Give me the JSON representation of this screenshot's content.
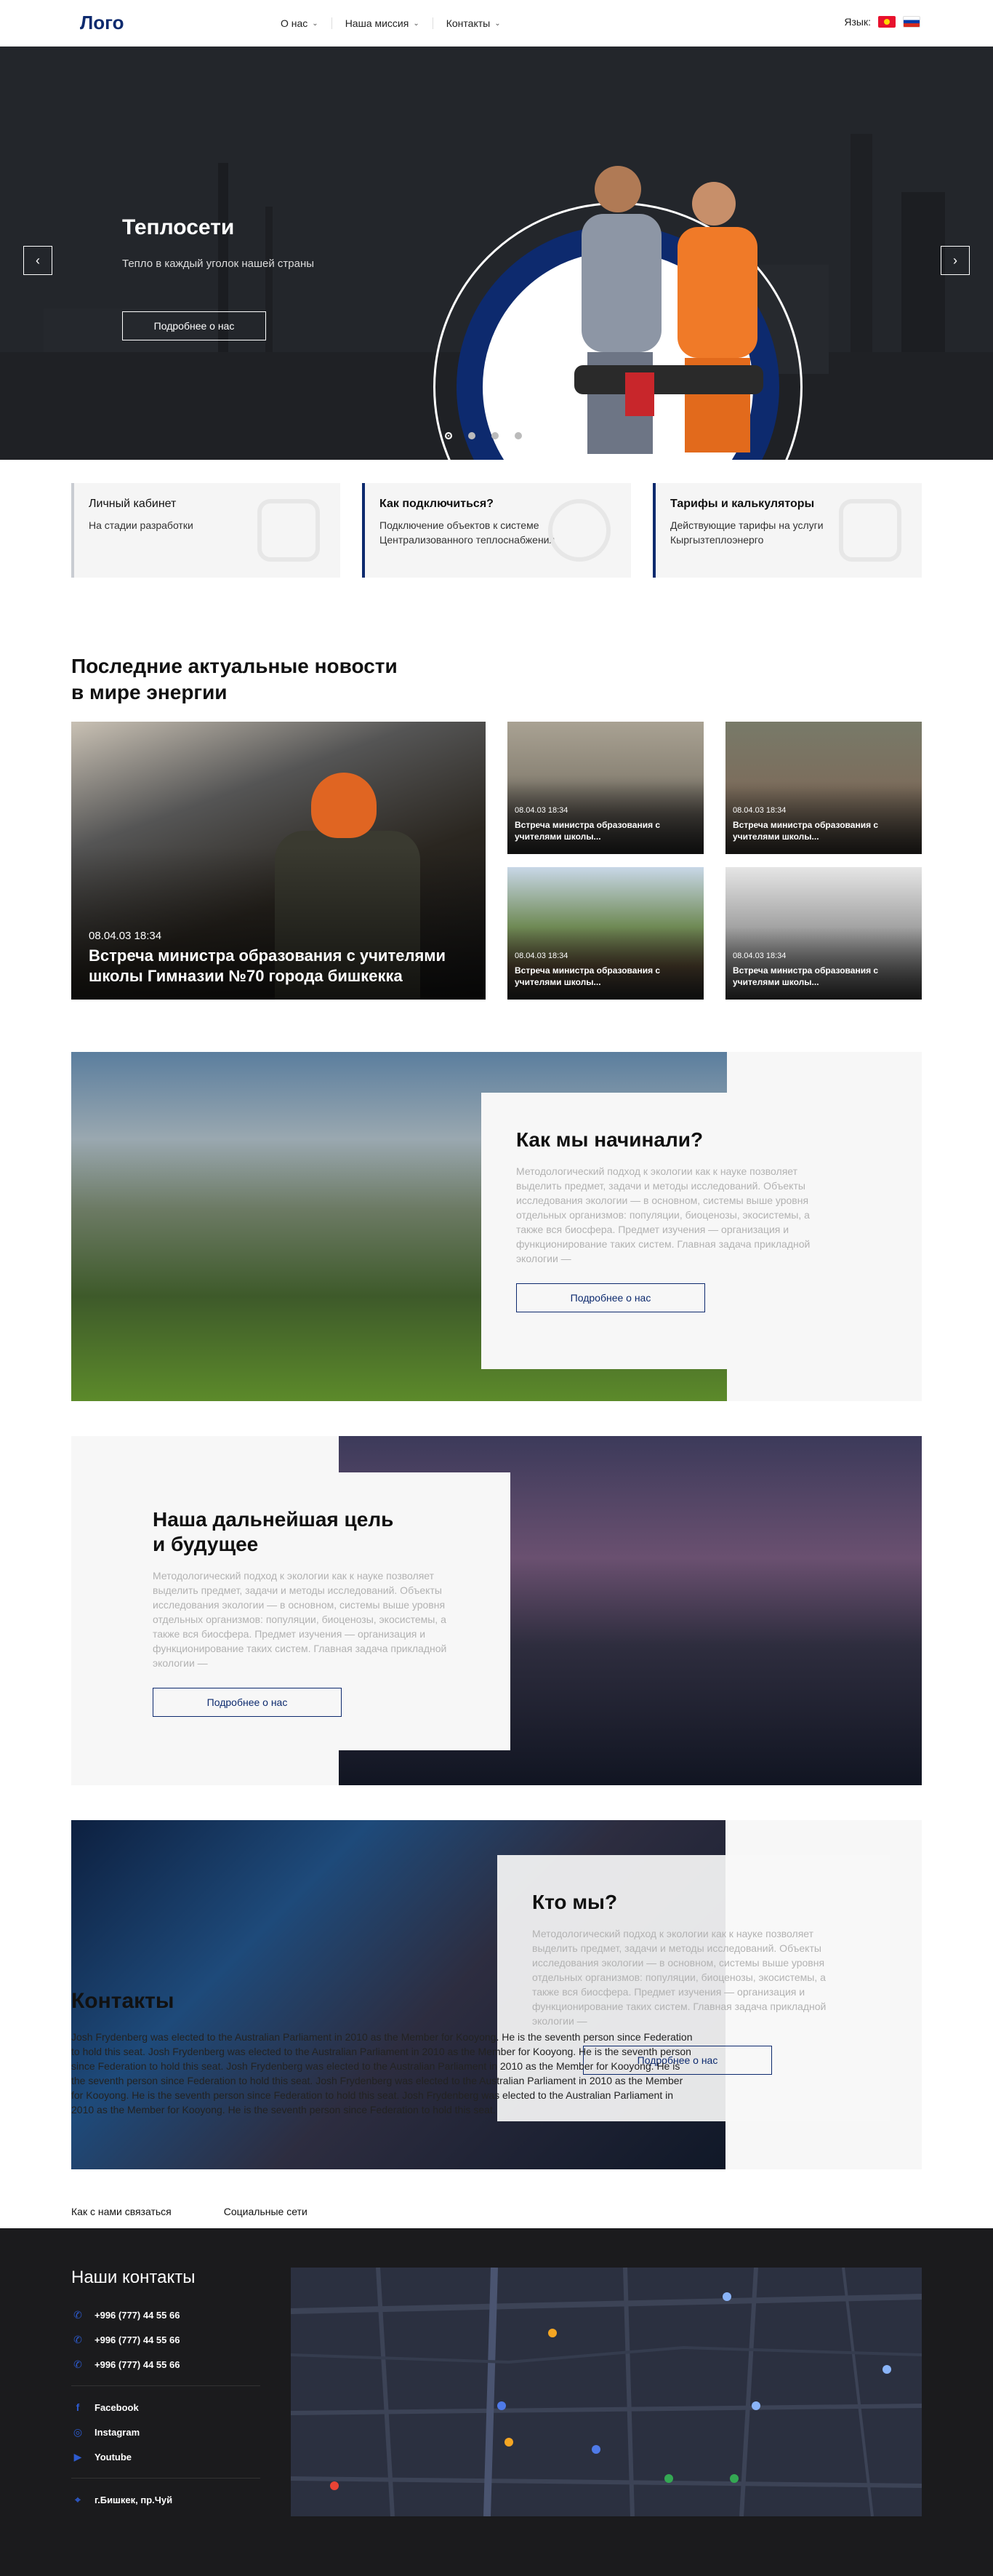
{
  "header": {
    "logo": "Лого",
    "nav": [
      {
        "label": "О нас"
      },
      {
        "label": "Наша миссия"
      },
      {
        "label": "Контакты"
      }
    ],
    "lang_label": "Язык:"
  },
  "hero": {
    "title": "Теплосети",
    "subtitle": "Тепло в каждый уголок нашей страны",
    "button": "Подробнее о нас",
    "prev": "‹",
    "next": "›"
  },
  "cards": [
    {
      "title": "Личный кабинет",
      "text": "На стадии разработки"
    },
    {
      "title": "Как подключиться?",
      "text": "Подключение объектов к системе Централизованного теплоснабжения"
    },
    {
      "title": "Тарифы и калькуляторы",
      "text": "Действующие тарифы на услуги Кыргызтеплоэнерго"
    }
  ],
  "news": {
    "heading_line1": "Последние актуальные новости",
    "heading_line2": "в мире энергии",
    "main": {
      "date": "08.04.03 18:34",
      "title": "Встреча министра образования с учителями школы Гимназии №70 города бишкекка"
    },
    "items": [
      {
        "date": "08.04.03 18:34",
        "title": "Встреча министра образования с учителями школы..."
      },
      {
        "date": "08.04.03 18:34",
        "title": "Встреча министра образования с учителями школы..."
      },
      {
        "date": "08.04.03 18:34",
        "title": "Встреча министра образования с учителями школы..."
      },
      {
        "date": "08.04.03 18:34",
        "title": "Встреча министра образования с учителями школы..."
      }
    ]
  },
  "features": [
    {
      "title": "Как мы начинали?",
      "text": "Методологический подход к экологии как к науке позволяет выделить предмет, задачи и методы исследований. Объекты исследования экологии — в основном, системы выше уровня отдельных организмов: популяции, биоценозы, экосистемы, а также вся биосфера. Предмет изучения — организация и функционирование таких систем. Главная задача прикладной экологии —",
      "button": "Подробнее о нас"
    },
    {
      "title_line1": "Наша дальнейшая цель",
      "title_line2": "и будущее",
      "text": "Методологический подход к экологии как к науке позволяет выделить предмет, задачи и методы исследований. Объекты исследования экологии — в основном, системы выше уровня отдельных организмов: популяции, биоценозы, экосистемы, а также вся биосфера. Предмет изучения — организация и функционирование таких систем. Главная задача прикладной экологии —",
      "button": "Подробнее о нас"
    },
    {
      "title": "Кто мы?",
      "text": "Методологический подход к экологии как к науке позволяет выделить предмет, задачи и методы исследований. Объекты исследования экологии — в основном, системы выше уровня отдельных организмов: популяции, биоценозы, экосистемы, а также вся биосфера. Предмет изучения — организация и функционирование таких систем. Главная задача прикладной экологии —",
      "button": "Подробнее о нас"
    }
  ],
  "contacts": {
    "heading": "Контакты",
    "paragraph": "Josh Frydenberg was elected to the Australian Parliament in 2010 as the Member for Kooyong. He is the seventh person since Federation to hold this seat.    Josh Frydenberg was elected to the Australian Parliament in 2010 as the Member for Kooyong. He is the seventh person since Federation to hold this seat.    Josh Frydenberg was elected to the Australian Parliament in 2010 as the Member for Kooyong. He is the seventh person since Federation to hold this seat.    Josh Frydenberg was elected to the Australian Parliament in 2010 as the Member for Kooyong. He is the seventh person since Federation to hold this seat.    Josh Frydenberg was elected to the Australian Parliament in 2010 as the Member for Kooyong. He is the seventh person since Federation to hold this seat.",
    "link_contact": "Как с нами связаться",
    "link_social": "Социальные сети"
  },
  "footer": {
    "title": "Наши контакты",
    "phones": [
      "+996 (777) 44 55 66",
      "+996 (777) 44 55 66",
      "+996 (777) 44 55 66"
    ],
    "socials": [
      "Facebook",
      "Instagram",
      "Youtube"
    ],
    "address": "г.Бишкек, пр.Чуй"
  }
}
